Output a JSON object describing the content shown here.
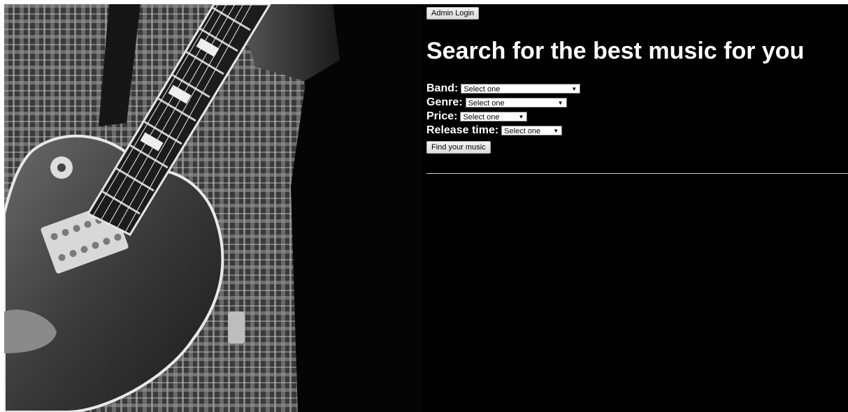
{
  "header": {
    "admin_login_label": "Admin Login",
    "title": "Search for the best music for you"
  },
  "filters": {
    "band_label": "Band:",
    "band_value": "Select one",
    "genre_label": "Genre:",
    "genre_value": "Select one",
    "price_label": "Price:",
    "price_value": "Select one",
    "release_label": "Release time:",
    "release_value": "Select one",
    "arrow_glyph": "▼",
    "find_label": "Find your music"
  },
  "icons": {
    "dropdown": "chevron-down-icon"
  },
  "colors": {
    "background": "#000000",
    "text": "#ffffff",
    "divider": "#d0d0d0"
  }
}
